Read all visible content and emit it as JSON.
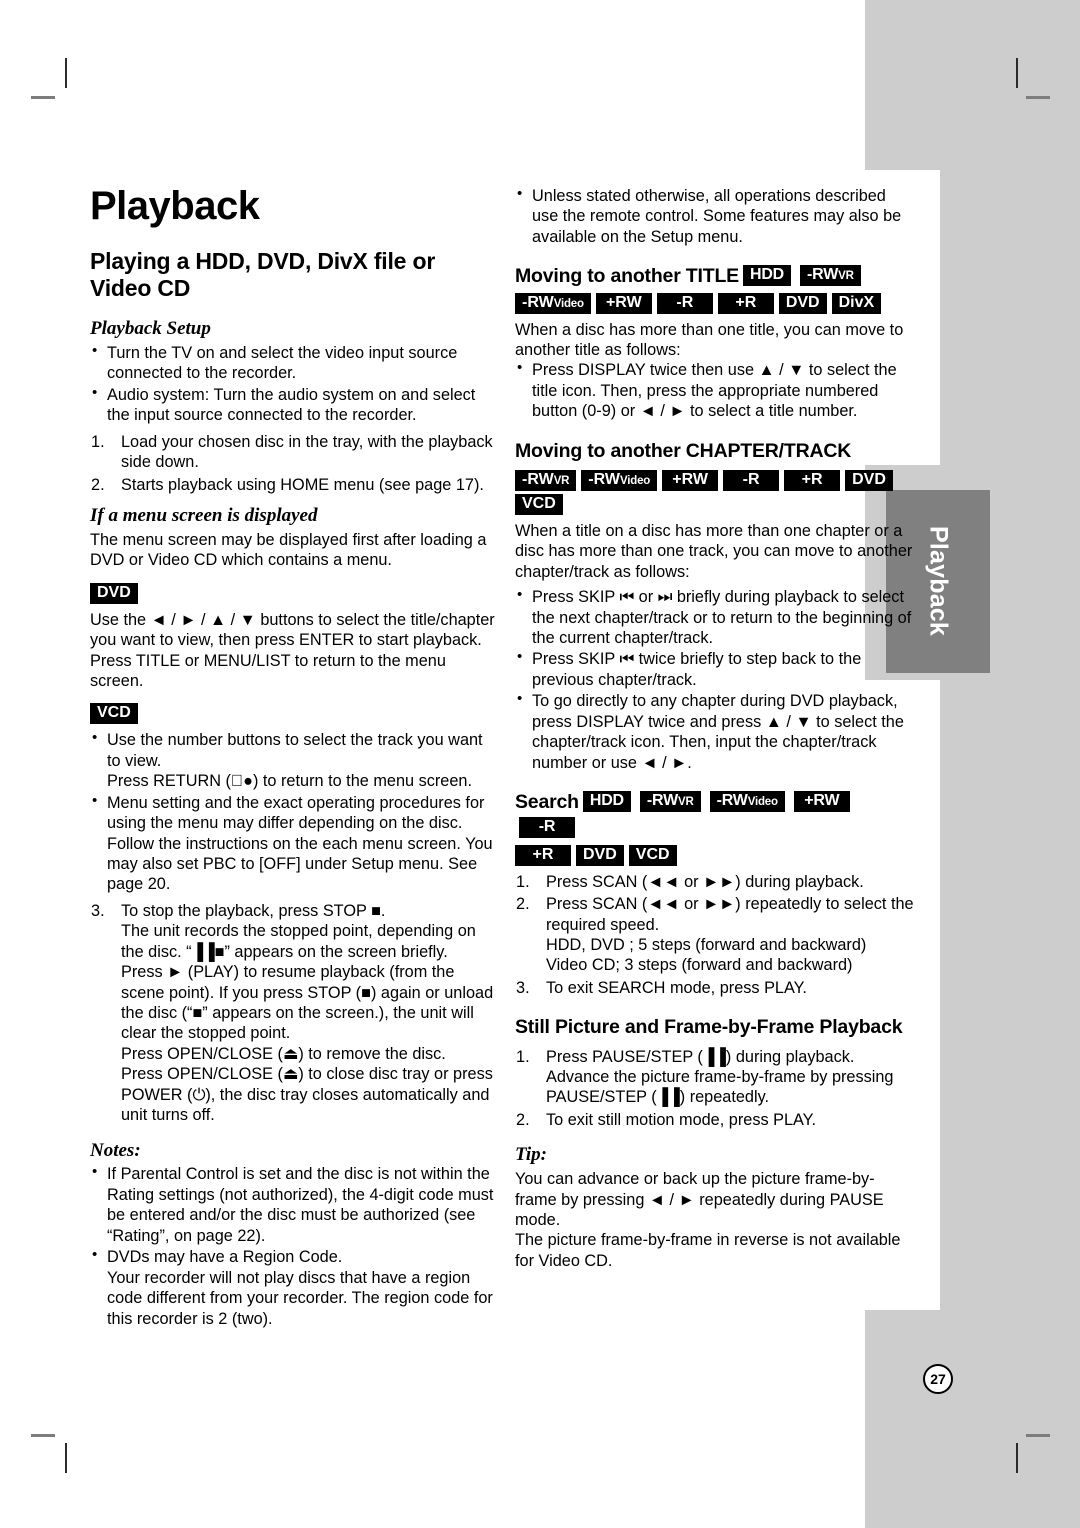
{
  "page": {
    "number": "27",
    "side_tab_label": "Playback",
    "chapter_title": "Playback"
  },
  "left_column": {
    "section_title": "Playing a HDD, DVD, DivX file or Video CD",
    "playback_setup": {
      "heading": "Playback Setup",
      "bullets": [
        "Turn the TV on and select the video input source connected to the recorder.",
        "Audio system: Turn the audio system on and select the input source connected to the recorder."
      ],
      "steps": [
        "Load your chosen disc in the tray, with the playback side down.",
        "Starts playback using HOME menu (see page 17)."
      ]
    },
    "menu_screen": {
      "heading": "If a menu screen is displayed",
      "intro": "The menu screen may be displayed first after loading a DVD or Video CD which contains a menu.",
      "dvd_badge": "DVD",
      "dvd_text_1": "Use the ◄ / ► / ▲ / ▼ buttons to select the title/chapter you want to view, then press ENTER to start playback.",
      "dvd_text_2": "Press TITLE or MENU/LIST to return to the menu screen.",
      "vcd_badge": "VCD",
      "vcd_bullet_1a": "Use the number buttons to select the track you want to view.",
      "vcd_bullet_1b": "Press RETURN (᪲●) to return to the menu screen.",
      "vcd_bullet_2": "Menu setting and the exact operating procedures for using the menu may differ depending on the disc. Follow the instructions on the each menu screen. You may also set PBC to [OFF] under Setup menu. See page 20."
    },
    "step3": {
      "label": "To stop the playback, press STOP ■.",
      "lines": [
        "The unit records the stopped point, depending on the disc. “▐▐■” appears on the screen briefly.",
        "Press ► (PLAY) to resume playback (from the scene point). If you press STOP (■) again or unload the disc (“■” appears on the screen.), the unit will clear the stopped point.",
        "Press OPEN/CLOSE (⏏) to remove the disc.",
        "Press OPEN/CLOSE (⏏) to close disc tray or press POWER (⏻), the disc tray closes automatically and unit turns off."
      ]
    },
    "notes": {
      "heading": "Notes:",
      "bullets": [
        "If Parental Control is set and the disc is not within the Rating settings (not authorized), the 4-digit code must be entered and/or the disc must be authorized (see “Rating”, on page 22).",
        "DVDs may have a Region Code.\nYour recorder will not play discs that have a region code different from your recorder. The region code for this recorder is 2 (two)."
      ],
      "bullet_2_line_1": "DVDs may have a Region Code.",
      "bullet_2_line_2": "Your recorder will not play discs that have a region code different from your recorder. The region code for this recorder is 2 (two)."
    }
  },
  "right_column": {
    "top_bullet": "Unless stated otherwise, all operations described use the remote control. Some features may also be available on the Setup menu.",
    "title_section": {
      "heading": "Moving to another TITLE",
      "badges_inline": [
        {
          "main": "HDD",
          "sub": ""
        },
        {
          "main": "-RW",
          "sub": "VR"
        }
      ],
      "badges_row": [
        {
          "main": "-RW",
          "sub": "Video"
        },
        {
          "main": "+RW",
          "sub": ""
        },
        {
          "main": "-R",
          "sub": ""
        },
        {
          "main": "+R",
          "sub": ""
        },
        {
          "main": "DVD",
          "sub": ""
        },
        {
          "main": "DivX",
          "sub": ""
        }
      ],
      "intro": "When a disc has more than one title, you can move to another title as follows:",
      "bullets": [
        "Press DISPLAY twice then use ▲ / ▼ to select the title icon. Then, press the appropriate numbered button (0-9) or ◄ / ► to select a title number."
      ]
    },
    "chapter_section": {
      "heading": "Moving to another CHAPTER/TRACK",
      "badges_row": [
        {
          "main": "-RW",
          "sub": "VR"
        },
        {
          "main": "-RW",
          "sub": "Video"
        },
        {
          "main": "+RW",
          "sub": ""
        },
        {
          "main": "-R",
          "sub": ""
        },
        {
          "main": "+R",
          "sub": ""
        },
        {
          "main": "DVD",
          "sub": ""
        },
        {
          "main": "VCD",
          "sub": ""
        }
      ],
      "intro": "When a title on a disc has more than one chapter or a disc has more than one track, you can move to another chapter/track as follows:",
      "bullets": [
        "Press SKIP ⏮ or ⏭ briefly during playback to select the next chapter/track or to return to the beginning of the current chapter/track.",
        "Press SKIP ⏮ twice briefly to step back to the previous chapter/track.",
        "To go directly to any chapter during DVD playback, press DISPLAY twice and press ▲ / ▼ to select the chapter/track icon. Then, input the chapter/track number or use ◄ / ►."
      ]
    },
    "search_section": {
      "heading": "Search",
      "badges_inline": [
        {
          "main": "HDD",
          "sub": ""
        },
        {
          "main": "-RW",
          "sub": "VR"
        },
        {
          "main": "-RW",
          "sub": "Video"
        },
        {
          "main": "+RW",
          "sub": ""
        },
        {
          "main": "-R",
          "sub": ""
        }
      ],
      "badges_row": [
        {
          "main": "+R",
          "sub": ""
        },
        {
          "main": "DVD",
          "sub": ""
        },
        {
          "main": "VCD",
          "sub": ""
        }
      ],
      "steps": [
        "Press SCAN (◄◄ or ►►) during playback.",
        "Press SCAN (◄◄ or ►►) repeatedly to select the required speed.",
        "To exit SEARCH mode, press PLAY."
      ],
      "step2_extra_1": "HDD, DVD ; 5 steps (forward and backward)",
      "step2_extra_2": "Video CD; 3 steps (forward and backward)"
    },
    "still_section": {
      "heading": "Still Picture and Frame-by-Frame Playback",
      "steps": [
        "Press PAUSE/STEP (▐▐) during playback. Advance the picture frame-by-frame by pressing PAUSE/STEP (▐▐) repeatedly.",
        "To exit still motion mode, press PLAY."
      ],
      "tip_heading": "Tip:",
      "tip_lines": [
        "You can advance or back up the picture frame-by-frame by pressing ◄ / ► repeatedly during PAUSE mode.",
        "The picture frame-by-frame in reverse is not available for Video CD."
      ]
    }
  }
}
